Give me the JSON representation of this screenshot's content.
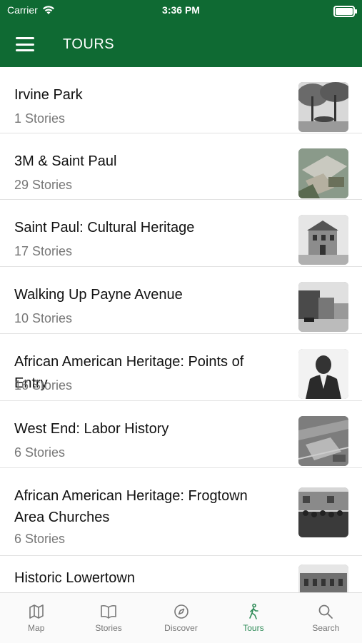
{
  "status": {
    "carrier": "Carrier",
    "time": "3:36 PM"
  },
  "header": {
    "title": "TOURS"
  },
  "tours": [
    {
      "name": "Irvine Park",
      "count": "1 Stories",
      "thumb": "park-photo"
    },
    {
      "name": "3M & Saint Paul",
      "count": "29 Stories",
      "thumb": "factory-aerial-photo"
    },
    {
      "name": "Saint Paul: Cultural Heritage",
      "count": "17 Stories",
      "thumb": "house-photo"
    },
    {
      "name": "Walking Up Payne Avenue",
      "count": "10 Stories",
      "thumb": "street-photo"
    },
    {
      "name": "African American Heritage: Points of Entry",
      "count": "16 Stories",
      "thumb": "portrait-photo"
    },
    {
      "name": "West End: Labor History",
      "count": "6 Stories",
      "thumb": "aerial-photo"
    },
    {
      "name": "African American Heritage: Frogtown Area Churches",
      "count": "6 Stories",
      "thumb": "crowd-photo"
    },
    {
      "name": "Historic Lowertown",
      "count": "",
      "thumb": "building-photo"
    }
  ],
  "tabs": [
    {
      "label": "Map",
      "icon": "map-icon"
    },
    {
      "label": "Stories",
      "icon": "book-icon"
    },
    {
      "label": "Discover",
      "icon": "compass-icon"
    },
    {
      "label": "Tours",
      "icon": "walking-icon",
      "active": true
    },
    {
      "label": "Search",
      "icon": "search-icon"
    }
  ],
  "colors": {
    "header": "#0f6a33",
    "active_tab": "#2e8b57"
  }
}
